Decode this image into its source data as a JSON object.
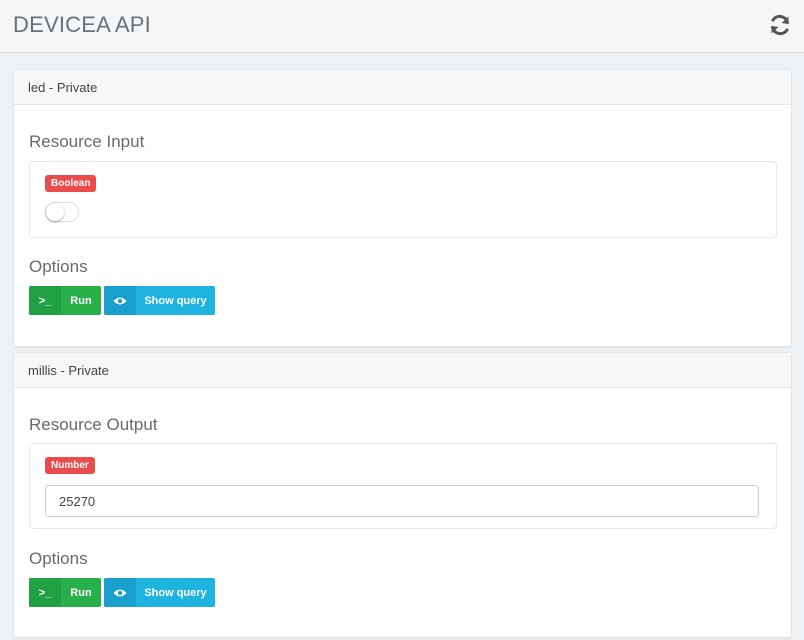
{
  "header": {
    "title": "DEVICEA API",
    "refresh_icon": "refresh-icon"
  },
  "panels": [
    {
      "heading": "led - Private",
      "section_title": "Resource Input",
      "type_badge": "Boolean",
      "toggle_on": false,
      "options_title": "Options",
      "run_label": "Run",
      "query_label": "Show query"
    },
    {
      "heading": "millis - Private",
      "section_title": "Resource Output",
      "type_badge": "Number",
      "value": "25270",
      "options_title": "Options",
      "run_label": "Run",
      "query_label": "Show query"
    }
  ],
  "colors": {
    "run_green": "#28b04b",
    "query_blue": "#1fb3e0",
    "badge_red": "#ea4b4b"
  }
}
